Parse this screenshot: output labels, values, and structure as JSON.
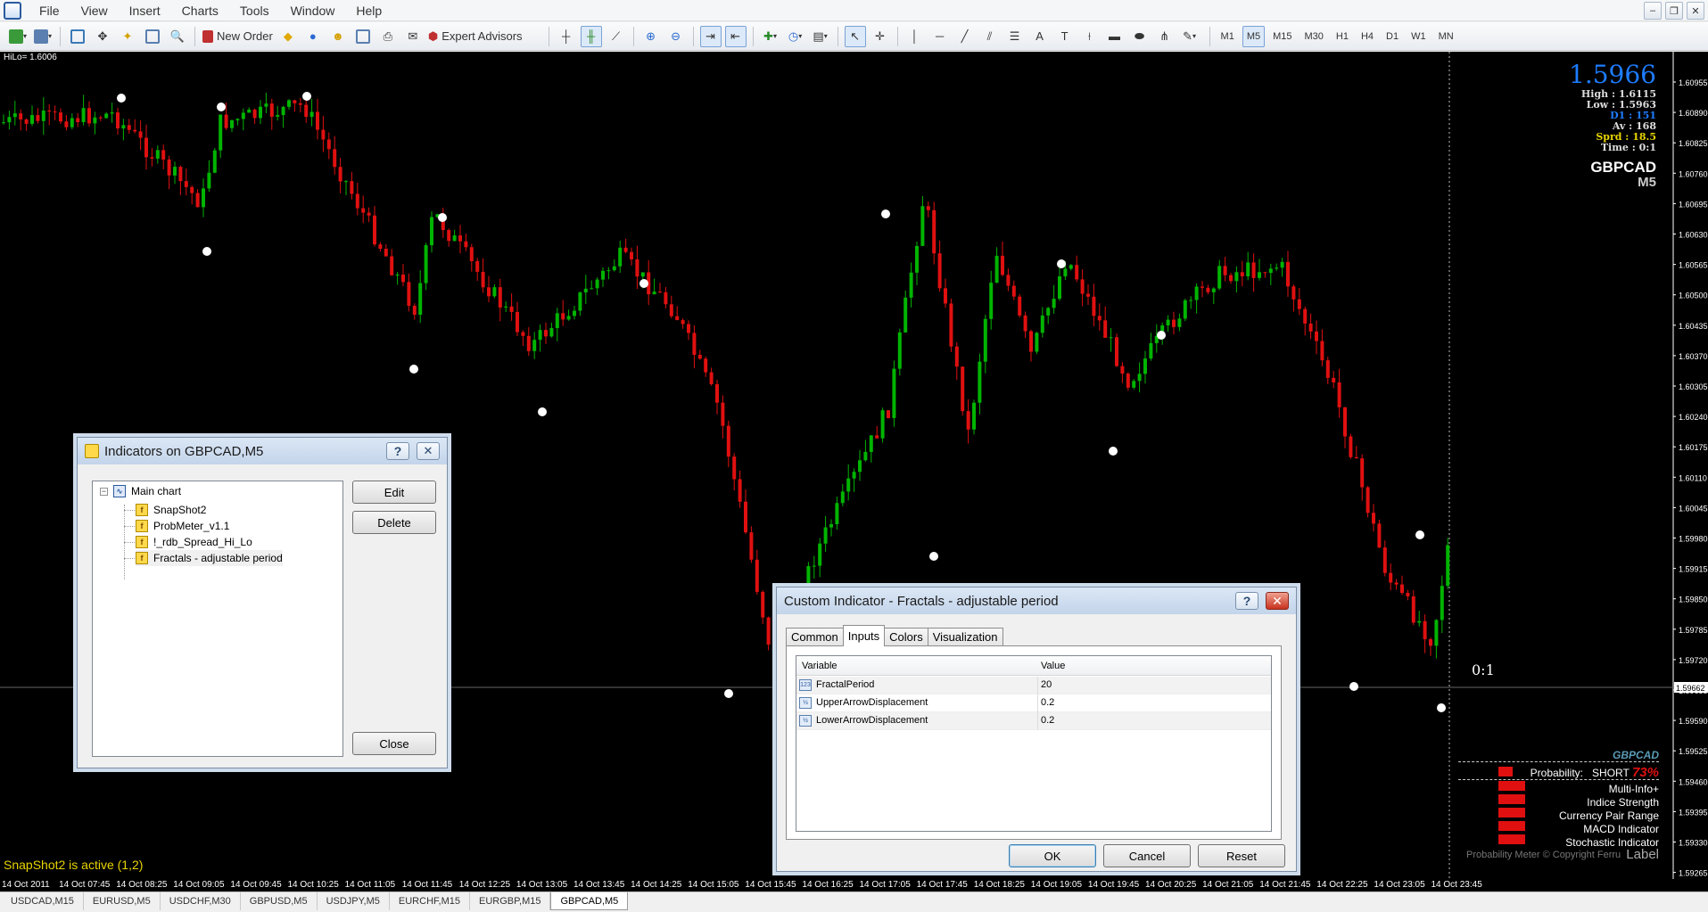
{
  "menu": [
    "File",
    "View",
    "Insert",
    "Charts",
    "Tools",
    "Window",
    "Help"
  ],
  "toolbar": {
    "new_order": "New Order",
    "expert_advisors": "Expert Advisors"
  },
  "timeframes": [
    "M1",
    "M5",
    "M15",
    "M30",
    "H1",
    "H4",
    "D1",
    "W1",
    "MN"
  ],
  "chart": {
    "hilo_label": "HiLo= 1.6006",
    "status_text": "SnapShot2 is active (1,2)",
    "ratio_label": "0:1",
    "current_price_tag": "1.59662",
    "price_axis": [
      "1.60955",
      "1.60890",
      "1.60825",
      "1.60760",
      "1.60695",
      "1.60630",
      "1.60565",
      "1.60500",
      "1.60435",
      "1.60370",
      "1.60305",
      "1.60240",
      "1.60175",
      "1.60110",
      "1.60045",
      "1.59980",
      "1.59915",
      "1.59850",
      "1.59785",
      "1.59720",
      "1.59655",
      "1.59590",
      "1.59525",
      "1.59460",
      "1.59395",
      "1.59330",
      "1.59265"
    ],
    "time_axis": [
      "14 Oct 2011",
      "14 Oct 07:45",
      "14 Oct 08:25",
      "14 Oct 09:05",
      "14 Oct 09:45",
      "14 Oct 10:25",
      "14 Oct 11:05",
      "14 Oct 11:45",
      "14 Oct 12:25",
      "14 Oct 13:05",
      "14 Oct 13:45",
      "14 Oct 14:25",
      "14 Oct 15:05",
      "14 Oct 15:45",
      "14 Oct 16:25",
      "14 Oct 17:05",
      "14 Oct 17:45",
      "14 Oct 18:25",
      "14 Oct 19:05",
      "14 Oct 19:45",
      "14 Oct 20:25",
      "14 Oct 21:05",
      "14 Oct 21:45",
      "14 Oct 22:25",
      "14 Oct 23:05",
      "14 Oct 23:45"
    ],
    "up_color": "#00b400",
    "down_color": "#e01010"
  },
  "info": {
    "price": "1.5966",
    "high_label": "High :",
    "high_value": "1.6115",
    "low_label": "Low :",
    "low_value": "1.5963",
    "d1_label": "D1 :",
    "d1_value": "151",
    "av_label": "Av :",
    "av_value": "168",
    "sprd_label": "Sprd :",
    "sprd_value": "18.5",
    "time_label": "Time :",
    "time_value": "0:1",
    "symbol": "GBPCAD",
    "timeframe": "M5"
  },
  "prob": {
    "symbol": "GBPCAD",
    "label": "Probability:",
    "direction": "SHORT",
    "percent": "73%",
    "items": [
      "Multi-Info+",
      "Indice Strength",
      "Currency Pair Range",
      "MACD Indicator",
      "Stochastic Indicator"
    ],
    "copyright": "Probability Meter © Copyright Ferru",
    "label_text": "Label"
  },
  "tabs": [
    "USDCAD,M15",
    "EURUSD,M5",
    "USDCHF,M30",
    "GBPUSD,M5",
    "USDJPY,M5",
    "EURCHF,M15",
    "EURGBP,M15",
    "GBPCAD,M5"
  ],
  "indicators_dialog": {
    "title": "Indicators on GBPCAD,M5",
    "tree_root": "Main chart",
    "tree_items": [
      "SnapShot2",
      "ProbMeter_v1.1",
      "!_rdb_Spread_Hi_Lo",
      "Fractals - adjustable period"
    ],
    "edit": "Edit",
    "delete": "Delete",
    "close": "Close"
  },
  "custom_dialog": {
    "title": "Custom Indicator - Fractals - adjustable period",
    "tabs": [
      "Common",
      "Inputs",
      "Colors",
      "Visualization"
    ],
    "col_variable": "Variable",
    "col_value": "Value",
    "rows": [
      {
        "icon": "123",
        "name": "FractalPeriod",
        "value": "20"
      },
      {
        "icon": "½",
        "name": "UpperArrowDisplacement",
        "value": "0.2"
      },
      {
        "icon": "½",
        "name": "LowerArrowDisplacement",
        "value": "0.2"
      }
    ],
    "ok": "OK",
    "cancel": "Cancel",
    "reset": "Reset"
  },
  "colors": {
    "bull": "#00b400",
    "bear": "#e01010",
    "price_blue": "#1e7cff",
    "status_yellow": "#e8d400"
  }
}
